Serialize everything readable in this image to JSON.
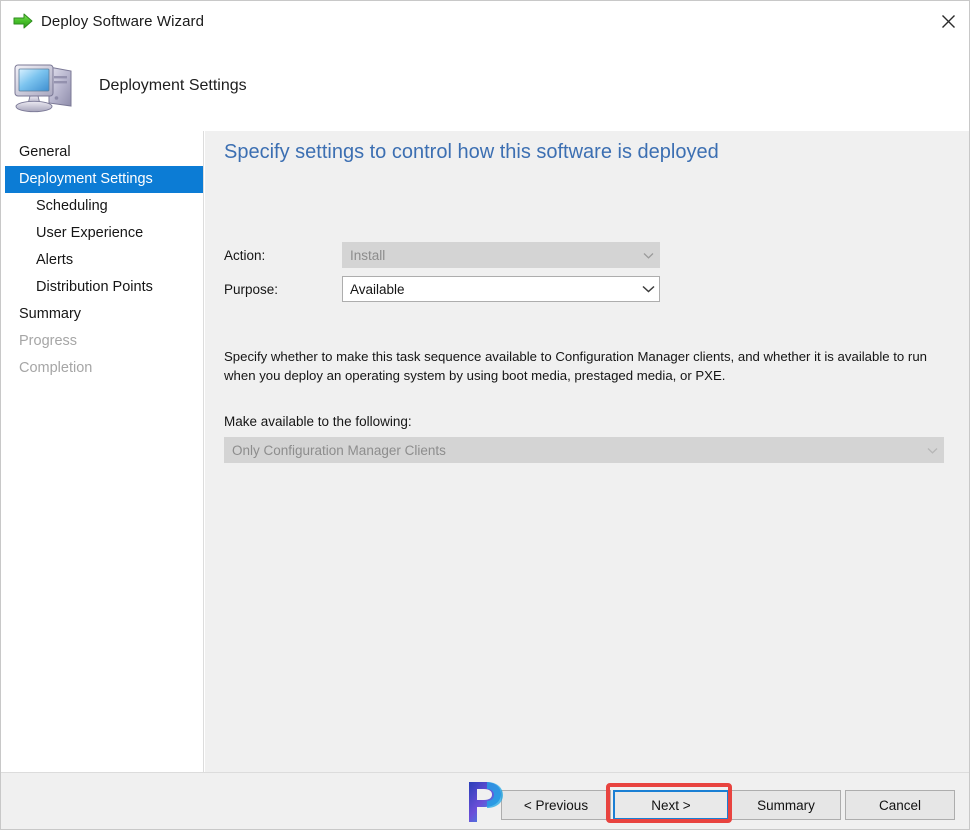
{
  "window": {
    "title": "Deploy Software Wizard",
    "title_icon": "green-arrow-icon",
    "close_label": "✕",
    "banner_title": "Deployment Settings",
    "banner_icon": "computer-icon"
  },
  "sidebar": {
    "items": [
      {
        "label": "General",
        "state": "normal",
        "indent": false
      },
      {
        "label": "Deployment Settings",
        "state": "selected",
        "indent": false
      },
      {
        "label": "Scheduling",
        "state": "normal",
        "indent": true
      },
      {
        "label": "User Experience",
        "state": "normal",
        "indent": true
      },
      {
        "label": "Alerts",
        "state": "normal",
        "indent": true
      },
      {
        "label": "Distribution Points",
        "state": "normal",
        "indent": true
      },
      {
        "label": "Summary",
        "state": "normal",
        "indent": false
      },
      {
        "label": "Progress",
        "state": "disabled",
        "indent": false
      },
      {
        "label": "Completion",
        "state": "disabled",
        "indent": false
      }
    ]
  },
  "content": {
    "heading": "Specify settings to control how this software is deployed",
    "action_label": "Action:",
    "action_value": "Install",
    "purpose_label": "Purpose:",
    "purpose_value": "Available",
    "description": "Specify whether to make this task sequence available to Configuration Manager clients, and whether it is available to run when you deploy an operating system by using boot media, prestaged media, or PXE.",
    "available_label": "Make available to the following:",
    "available_value": "Only Configuration Manager Clients"
  },
  "footer": {
    "previous_label": "< Previous",
    "next_label": "Next >",
    "summary_label": "Summary",
    "cancel_label": "Cancel"
  },
  "colors": {
    "accent_selection": "#0c7cd5",
    "heading_blue": "#3c6fb2",
    "highlight_red": "#e8433f",
    "focus_blue": "#1a7fd4",
    "content_bg": "#f0f0f0"
  }
}
